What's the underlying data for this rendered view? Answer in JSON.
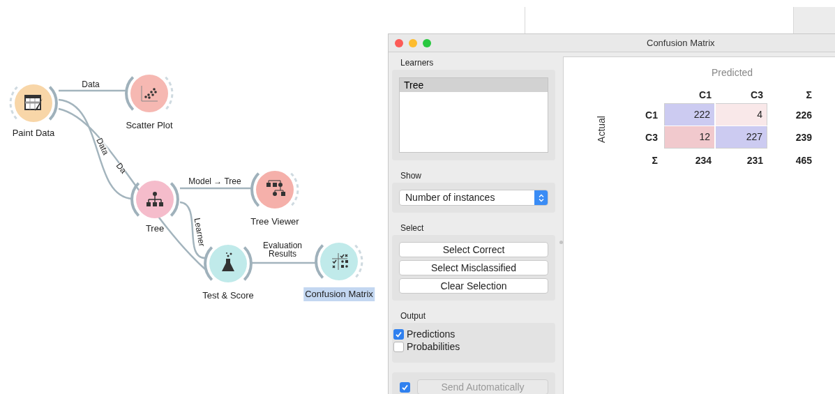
{
  "canvas": {
    "nodes": [
      {
        "kind": "paint",
        "label": "Paint Data",
        "color": "#f8d6a8",
        "selected": false
      },
      {
        "kind": "scatter",
        "label": "Scatter Plot",
        "color": "#f6b8b2",
        "selected": false
      },
      {
        "kind": "tree",
        "label": "Tree",
        "color": "#f5bccb",
        "selected": false
      },
      {
        "kind": "treeviewer",
        "label": "Tree Viewer",
        "color": "#f5b0aa",
        "selected": false
      },
      {
        "kind": "testscore",
        "label": "Test & Score",
        "color": "#c0eaea",
        "selected": false
      },
      {
        "kind": "confusion",
        "label": "Confusion Matrix",
        "color": "#c0eaea",
        "selected": true
      }
    ],
    "links": [
      "Data",
      "Data",
      "Da",
      "Model → Tree",
      "Learner",
      "Evaluation Results"
    ]
  },
  "window": {
    "title": "Confusion Matrix",
    "learners": {
      "title": "Learners",
      "items": [
        {
          "label": "Tree",
          "selected": true
        }
      ]
    },
    "show": {
      "title": "Show",
      "value": "Number of instances"
    },
    "select": {
      "title": "Select",
      "buttons": [
        "Select Correct",
        "Select Misclassified",
        "Clear Selection"
      ]
    },
    "output": {
      "title": "Output",
      "options": [
        {
          "label": "Predictions",
          "checked": true
        },
        {
          "label": "Probabilities",
          "checked": false
        }
      ]
    },
    "auto_send": {
      "checked": true,
      "label": "Send Automatically",
      "disabled": true
    },
    "matrix": {
      "column_title": "Predicted",
      "row_title": "Actual",
      "columns": [
        "C1",
        "C3",
        "Σ"
      ],
      "rows": [
        {
          "label": "C1",
          "cells": [
            {
              "value": "222",
              "color": "#cccbf1"
            },
            {
              "value": "4",
              "color": "#f9e8e9"
            }
          ],
          "total": "226"
        },
        {
          "label": "C3",
          "cells": [
            {
              "value": "12",
              "color": "#f1c9cd"
            },
            {
              "value": "227",
              "color": "#cccbf1"
            }
          ],
          "total": "239"
        }
      ],
      "totals": {
        "label": "Σ",
        "values": [
          "234",
          "231",
          "465"
        ]
      }
    }
  }
}
